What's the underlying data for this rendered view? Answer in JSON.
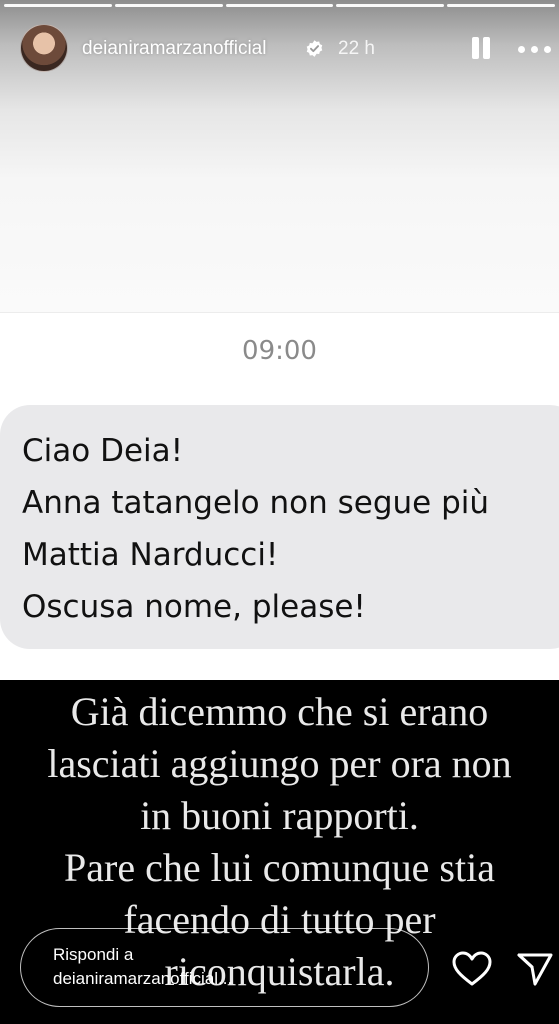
{
  "story": {
    "message_time": "09:00",
    "message_lines": [
      "Ciao Deia!",
      "Anna tatangelo non segue più",
      "Mattia Narducci!",
      "Oscusa nome, please!"
    ],
    "caption_lines": [
      "Già dicemmo che si erano",
      "lasciati aggiungo per ora non",
      "in buoni rapporti.",
      "Pare che lui comunque stia",
      "facendo di tutto per",
      "riconquistarla."
    ]
  },
  "progress": {
    "segments": 5,
    "current_segment": 5
  },
  "header": {
    "username": "deianiramarzanofficial",
    "verified": true,
    "time_ago": "22 h",
    "icons": [
      "pause-icon",
      "more-icon"
    ]
  },
  "reply": {
    "line1": "Rispondi a",
    "line2": "deianiramarzanofficial..."
  },
  "actions": {
    "icons": [
      "heart-icon",
      "send-icon"
    ]
  },
  "colors": {
    "bubble": "#e9e9eb",
    "caption_background": "#000000",
    "caption_text": "#e9e9e9",
    "message_time": "#8a8a8a",
    "verified_badge": "#ffffff"
  }
}
